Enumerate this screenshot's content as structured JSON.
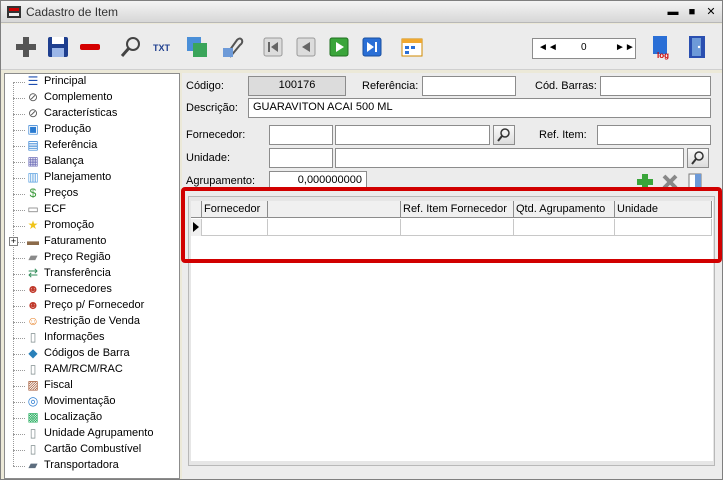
{
  "window": {
    "title": "Cadastro de Item"
  },
  "toolbar": {
    "buttons": [
      {
        "id": "add",
        "icon": "plus-icon"
      },
      {
        "id": "save",
        "icon": "floppy-icon"
      },
      {
        "id": "delete",
        "icon": "minus-icon"
      },
      {
        "id": "search",
        "icon": "magnifier-icon"
      },
      {
        "id": "txt",
        "icon": "txt-icon",
        "label": "TXT"
      },
      {
        "id": "export",
        "icon": "export-icon"
      },
      {
        "id": "attach",
        "icon": "paperclip-icon"
      },
      {
        "id": "first",
        "icon": "first-record-icon"
      },
      {
        "id": "prev",
        "icon": "prev-record-icon"
      },
      {
        "id": "next",
        "icon": "next-record-icon"
      },
      {
        "id": "last",
        "icon": "last-record-icon"
      },
      {
        "id": "calendar",
        "icon": "calendar-icon"
      },
      {
        "id": "log",
        "icon": "log-icon",
        "label": "log"
      },
      {
        "id": "exit",
        "icon": "exit-door-icon"
      }
    ],
    "record_nav": {
      "first": "◄◄",
      "value": "0",
      "last": "►►"
    }
  },
  "tree": {
    "items": [
      {
        "label": "Principal",
        "icon": "list-icon",
        "color": "#1f4fb0"
      },
      {
        "label": "Complemento",
        "icon": "paperclip-icon",
        "color": "#555555"
      },
      {
        "label": "Características",
        "icon": "paperclip-icon",
        "color": "#555555"
      },
      {
        "label": "Produção",
        "icon": "production-icon",
        "color": "#2a7bd1"
      },
      {
        "label": "Referência",
        "icon": "reference-icon",
        "color": "#2a7bd1"
      },
      {
        "label": "Balança",
        "icon": "scale-icon",
        "color": "#6b6bb6"
      },
      {
        "label": "Planejamento",
        "icon": "planning-icon",
        "color": "#5aa0e0"
      },
      {
        "label": "Preços",
        "icon": "money-icon",
        "color": "#3b9a3b"
      },
      {
        "label": "ECF",
        "icon": "printer-icon",
        "color": "#7a7a7a"
      },
      {
        "label": "Promoção",
        "icon": "star-icon",
        "color": "#f0c419"
      },
      {
        "label": "Faturamento",
        "icon": "billing-icon",
        "color": "#8c6b4a",
        "expandable": true,
        "expander": "+"
      },
      {
        "label": "Preço Região",
        "icon": "truck-icon",
        "color": "#8a8a8a"
      },
      {
        "label": "Transferência",
        "icon": "transfer-icon",
        "color": "#2e8b57"
      },
      {
        "label": "Fornecedores",
        "icon": "people-icon",
        "color": "#c0392b"
      },
      {
        "label": "Preço p/ Fornecedor",
        "icon": "people-icon",
        "color": "#c0392b"
      },
      {
        "label": "Restrição de Venda",
        "icon": "person-key-icon",
        "color": "#e67e22"
      },
      {
        "label": "Informações",
        "icon": "document-icon",
        "color": "#7f8c8d"
      },
      {
        "label": "Códigos de Barra",
        "icon": "shapes-icon",
        "color": "#2980b9"
      },
      {
        "label": "RAM/RCM/RAC",
        "icon": "document-icon",
        "color": "#7f8c8d"
      },
      {
        "label": "Fiscal",
        "icon": "fiscal-icon",
        "color": "#a0522d"
      },
      {
        "label": "Movimentação",
        "icon": "search-doc-icon",
        "color": "#2a7bd1"
      },
      {
        "label": "Localização",
        "icon": "location-icon",
        "color": "#27ae60"
      },
      {
        "label": "Unidade Agrupamento",
        "icon": "document-icon",
        "color": "#7f8c8d"
      },
      {
        "label": "Cartão Combustível",
        "icon": "document-icon",
        "color": "#7f8c8d"
      },
      {
        "label": "Transportadora",
        "icon": "truck-icon",
        "color": "#5d6d7e"
      }
    ]
  },
  "form": {
    "codigo": {
      "label": "Código:",
      "value": "100176"
    },
    "referencia": {
      "label": "Referência:",
      "value": ""
    },
    "cod_barras": {
      "label": "Cód. Barras:",
      "value": ""
    },
    "descricao": {
      "label": "Descrição:",
      "value": "GUARAVITON ACAI 500 ML"
    },
    "fornecedor": {
      "label": "Fornecedor:",
      "code": "",
      "name": ""
    },
    "ref_item": {
      "label": "Ref. Item:",
      "value": ""
    },
    "unidade": {
      "label": "Unidade:",
      "code": "",
      "name": ""
    },
    "agrupamento": {
      "label": "Agrupamento:",
      "value": "0,000000000"
    }
  },
  "grid": {
    "columns": [
      "Fornecedor",
      "",
      "Ref. Item Fornecedor",
      "Qtd. Agrupamento",
      "Unidade"
    ],
    "rows": [
      [
        "",
        "",
        "",
        "",
        ""
      ]
    ]
  },
  "colors": {
    "highlight_border": "#d10000"
  }
}
